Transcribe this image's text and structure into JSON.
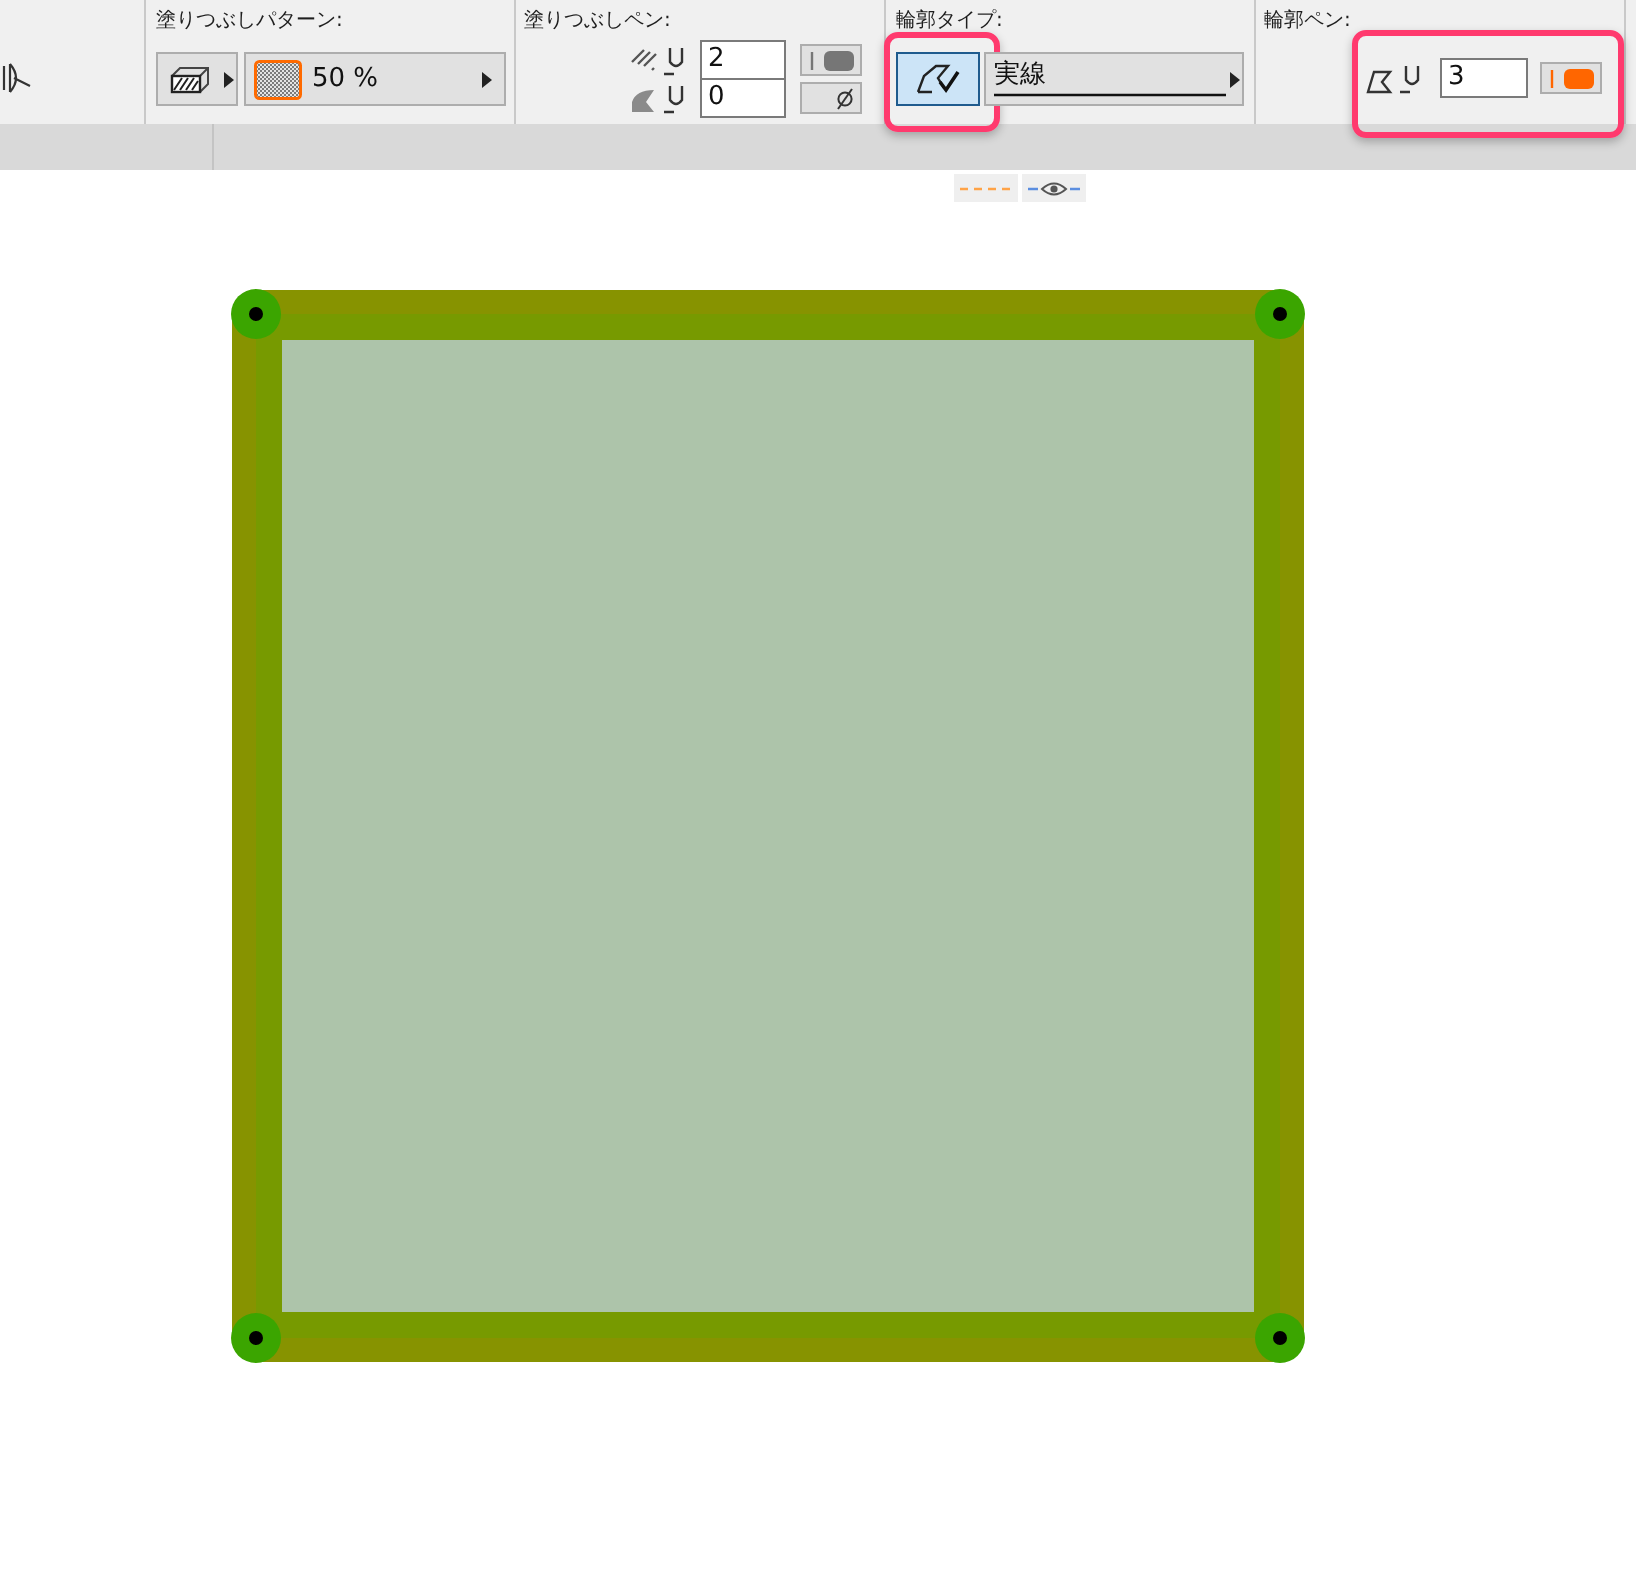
{
  "toolbar": {
    "fill_pattern": {
      "label": "塗りつぶしパターン:",
      "value": "50 %"
    },
    "fill_pen": {
      "label": "塗りつぶしペン:",
      "pens": [
        {
          "kind": "foreground",
          "number": "2",
          "color": "#767676"
        },
        {
          "kind": "background",
          "number": "0"
        }
      ]
    },
    "outline_type": {
      "label": "輪郭タイプ:",
      "toggle_selected": true,
      "highlighted": true,
      "line_type": "実線"
    },
    "outline_pen": {
      "label": "輪郭ペン:",
      "number": "3",
      "color": "#ff6600",
      "highlighted": true
    }
  }
}
